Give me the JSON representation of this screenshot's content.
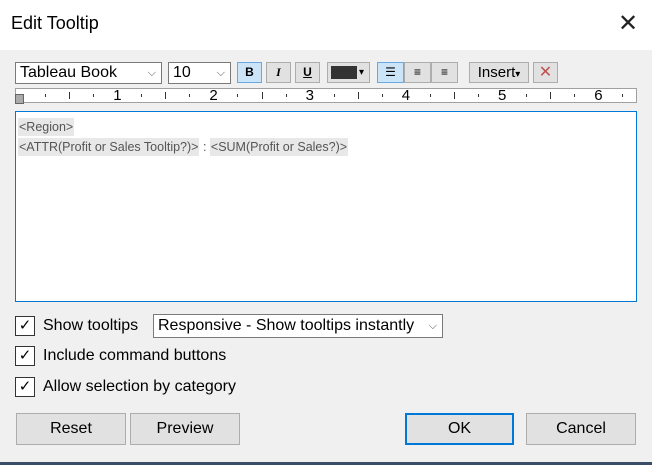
{
  "window": {
    "title": "Edit Tooltip",
    "close": "✕"
  },
  "toolbar": {
    "font": "Tableau Book",
    "size": "10",
    "bold": "B",
    "italic": "I",
    "underline": "U",
    "insert": "Insert",
    "clear": "✕",
    "chevron": "⌵",
    "caret": "▾"
  },
  "ruler": {
    "labels": [
      "1",
      "2",
      "3",
      "4",
      "5",
      "6"
    ]
  },
  "editor": {
    "line1": "<Region>",
    "line2a": "<ATTR(Profit or Sales Tooltip?)>",
    "sep": " : ",
    "line2b": "<SUM(Profit or Sales?)>"
  },
  "options": {
    "show_tooltips": "Show tooltips",
    "tooltip_mode": "Responsive - Show tooltips instantly",
    "include_buttons": "Include command buttons",
    "allow_selection": "Allow selection by category",
    "check": "✓"
  },
  "buttons": {
    "reset": "Reset",
    "preview": "Preview",
    "ok": "OK",
    "cancel": "Cancel"
  },
  "colors": {
    "accent": "#0078d7",
    "font_color": "#333333",
    "clear": "#c0504d"
  }
}
